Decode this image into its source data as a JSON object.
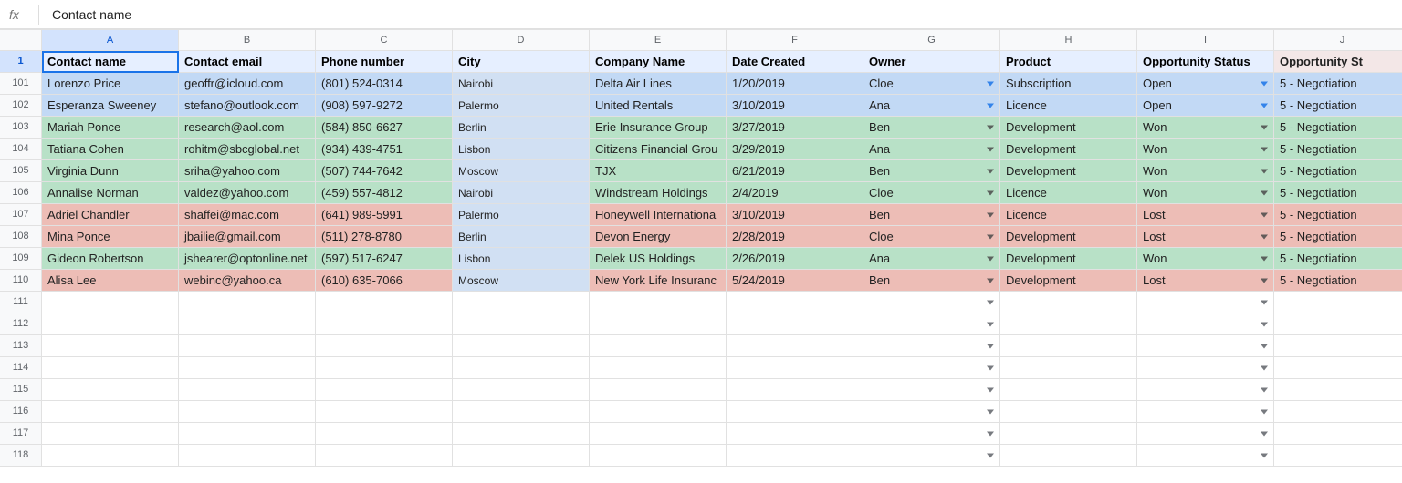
{
  "formula_bar": {
    "value": "Contact name"
  },
  "col_letters": [
    "A",
    "B",
    "C",
    "D",
    "E",
    "F",
    "G",
    "H",
    "I",
    "J"
  ],
  "active_col_index": 0,
  "active_row_index": 0,
  "headers": {
    "contact_name": "Contact name",
    "contact_email": "Contact email",
    "phone_number": "Phone number",
    "city": "City",
    "company": "Company Name",
    "date": "Date Created",
    "owner": "Owner",
    "product": "Product",
    "opp_status": "Opportunity Status",
    "opp_stage": "Opportunity St"
  },
  "data_row_numbers": [
    101,
    102,
    103,
    104,
    105,
    106,
    107,
    108,
    109,
    110
  ],
  "empty_row_numbers": [
    111,
    112,
    113,
    114,
    115,
    116,
    117,
    118
  ],
  "stage_text": "5 - Negotiation",
  "rows": [
    {
      "name": "Lorenzo Price",
      "email": "geoffr@icloud.com",
      "phone": "(801) 524-0314",
      "city": "Nairobi",
      "company": "Delta Air Lines",
      "date": "1/20/2019",
      "owner": "Cloe",
      "product": "Subscription",
      "status": "Open",
      "stat": "open"
    },
    {
      "name": "Esperanza Sweeney",
      "email": "stefano@outlook.com",
      "phone": "(908) 597-9272",
      "city": "Palermo",
      "company": "United Rentals",
      "date": "3/10/2019",
      "owner": "Ana",
      "product": "Licence",
      "status": "Open",
      "stat": "open"
    },
    {
      "name": "Mariah Ponce",
      "email": "research@aol.com",
      "phone": "(584) 850-6627",
      "city": "Berlin",
      "company": "Erie Insurance Group",
      "date": "3/27/2019",
      "owner": "Ben",
      "product": "Development",
      "status": "Won",
      "stat": "won"
    },
    {
      "name": "Tatiana Cohen",
      "email": "rohitm@sbcglobal.net",
      "phone": "(934) 439-4751",
      "city": "Lisbon",
      "company": "Citizens Financial Grou",
      "date": "3/29/2019",
      "owner": "Ana",
      "product": "Development",
      "status": "Won",
      "stat": "won"
    },
    {
      "name": "Virginia Dunn",
      "email": "sriha@yahoo.com",
      "phone": "(507) 744-7642",
      "city": "Moscow",
      "company": "TJX",
      "date": "6/21/2019",
      "owner": "Ben",
      "product": "Development",
      "status": "Won",
      "stat": "won"
    },
    {
      "name": "Annalise Norman",
      "email": "valdez@yahoo.com",
      "phone": "(459) 557-4812",
      "city": "Nairobi",
      "company": "Windstream Holdings",
      "date": "2/4/2019",
      "owner": "Cloe",
      "product": "Licence",
      "status": "Won",
      "stat": "won"
    },
    {
      "name": "Adriel Chandler",
      "email": "shaffei@mac.com",
      "phone": "(641) 989-5991",
      "city": "Palermo",
      "company": "Honeywell Internationa",
      "date": "3/10/2019",
      "owner": "Ben",
      "product": "Licence",
      "status": "Lost",
      "stat": "lost"
    },
    {
      "name": "Mina Ponce",
      "email": "jbailie@gmail.com",
      "phone": "(511) 278-8780",
      "city": "Berlin",
      "company": "Devon Energy",
      "date": "2/28/2019",
      "owner": "Cloe",
      "product": "Development",
      "status": "Lost",
      "stat": "lost"
    },
    {
      "name": "Gideon Robertson",
      "email": "jshearer@optonline.net",
      "phone": "(597) 517-6247",
      "city": "Lisbon",
      "company": "Delek US Holdings",
      "date": "2/26/2019",
      "owner": "Ana",
      "product": "Development",
      "status": "Won",
      "stat": "won"
    },
    {
      "name": "Alisa Lee",
      "email": "webinc@yahoo.ca",
      "phone": "(610) 635-7066",
      "city": "Moscow",
      "company": "New York Life Insuranc",
      "date": "5/24/2019",
      "owner": "Ben",
      "product": "Development",
      "status": "Lost",
      "stat": "lost"
    }
  ]
}
